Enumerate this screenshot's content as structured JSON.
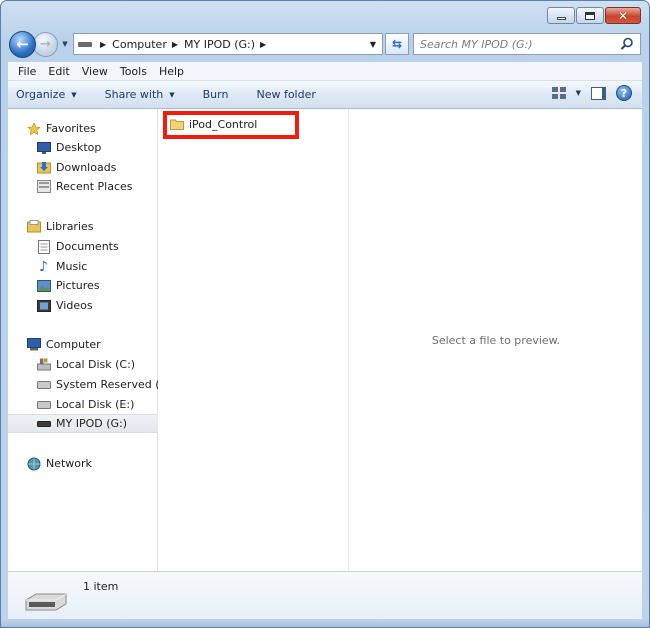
{
  "window": {
    "caption_buttons": {
      "minimize": "minimize",
      "maximize": "maximize",
      "close": "close"
    }
  },
  "address": {
    "crumbs": [
      "Computer",
      "MY IPOD (G:)"
    ]
  },
  "search": {
    "placeholder": "Search MY IPOD (G:)"
  },
  "menu": [
    "File",
    "Edit",
    "View",
    "Tools",
    "Help"
  ],
  "commands": {
    "organize": "Organize",
    "share_with": "Share with",
    "burn": "Burn",
    "new_folder": "New folder"
  },
  "nav": {
    "favorites": {
      "label": "Favorites",
      "items": [
        "Desktop",
        "Downloads",
        "Recent Places"
      ]
    },
    "libraries": {
      "label": "Libraries",
      "items": [
        "Documents",
        "Music",
        "Pictures",
        "Videos"
      ]
    },
    "computer": {
      "label": "Computer",
      "items": [
        "Local Disk (C:)",
        "System Reserved (D:",
        "Local Disk (E:)",
        "MY IPOD (G:)"
      ]
    },
    "network": {
      "label": "Network"
    }
  },
  "files": [
    {
      "name": "iPod_Control",
      "type": "folder"
    }
  ],
  "preview": {
    "message": "Select a file to preview."
  },
  "details": {
    "count": "1 item"
  },
  "colors": {
    "highlight": "#f01c0c",
    "accent": "#2a6fc4"
  }
}
